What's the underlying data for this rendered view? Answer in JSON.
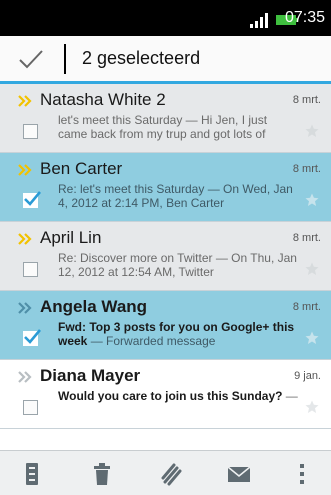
{
  "status": {
    "time": "07:35"
  },
  "action_bar": {
    "title": "2 geselecteerd"
  },
  "messages": [
    {
      "sender": "Natasha White",
      "count": "2",
      "date": "8 mrt.",
      "preview": "let's meet this Saturday — Hi Jen, I just came back from my trup and got lots of",
      "subject": "",
      "state": "read",
      "selected": false
    },
    {
      "sender": "Ben Carter",
      "date": "8 mrt.",
      "preview": "Re: let's meet this Saturday — On Wed, Jan 4, 2012 at 2:14 PM, Ben Carter",
      "subject": "",
      "state": "selected",
      "selected": true
    },
    {
      "sender": "April Lin",
      "date": "8 mrt.",
      "preview": "Re: Discover more on Twitter — On Thu, Jan 12, 2012 at 12:54 AM, Twitter",
      "subject": "",
      "state": "read",
      "selected": false
    },
    {
      "sender": "Angela Wang",
      "date": "8 mrt.",
      "subject": "Fwd: Top 3 posts for you on Google+ this week",
      "preview": " — Forwarded message",
      "state": "selected",
      "selected": true
    },
    {
      "sender": "Diana Mayer",
      "date": "9 jan.",
      "subject": "Would you care to join us this Sunday?",
      "preview": " —",
      "state": "unread",
      "selected": false
    }
  ],
  "bottom_bar": [
    "move-icon",
    "delete-icon",
    "attach-icon",
    "mail-icon",
    "more-icon"
  ],
  "colors": {
    "accent": "#32a8e0",
    "selected_bg": "#8fcde0",
    "read_bg": "#e6e8ea",
    "chevron": "#f2c200"
  }
}
